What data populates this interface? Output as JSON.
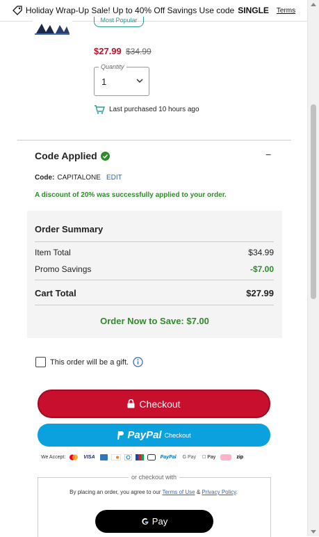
{
  "banner": {
    "text": "Holiday Wrap-Up Sale! Up to 40% Off Savings Use code",
    "code": "SINGLE",
    "terms": "Terms"
  },
  "product": {
    "badge": "Most Popular",
    "price_now": "$27.99",
    "price_was": "$34.99",
    "quantity_label": "Quantity",
    "quantity_value": "1",
    "last_purchased": "Last purchased 10 hours ago"
  },
  "code_applied": {
    "title": "Code Applied",
    "code_label": "Code:",
    "code_value": "CAPITALONE",
    "edit": "EDIT",
    "success": "A discount of 20% was successfully applied to your order."
  },
  "summary": {
    "title": "Order Summary",
    "rows": [
      {
        "label": "Item Total",
        "value": "$34.99"
      },
      {
        "label": "Promo Savings",
        "value": "-$7.00"
      }
    ],
    "total_label": "Cart Total",
    "total_value": "$27.99",
    "save_line": "Order Now to Save: $7.00"
  },
  "gift": {
    "label": "This order will be a gift."
  },
  "checkout": {
    "label": "Checkout"
  },
  "paypal": {
    "brand": "PayPal",
    "label": "Checkout"
  },
  "accept": {
    "label": "We Accept:",
    "logos": [
      "VISA",
      "PayPal",
      "G Pay",
      "Pay",
      "zip"
    ]
  },
  "alt": {
    "or_label": "or checkout with",
    "agree_prefix": "By placing an order, you agree to our",
    "terms_link": "Terms of Use",
    "amp": "&",
    "privacy_link": "Privacy Policy",
    "period": ".",
    "gpay": "Pay"
  },
  "colors": {
    "brand_red": "#c8102e",
    "paypal_blue": "#0aa1de",
    "success_green": "#2f8a2b"
  }
}
